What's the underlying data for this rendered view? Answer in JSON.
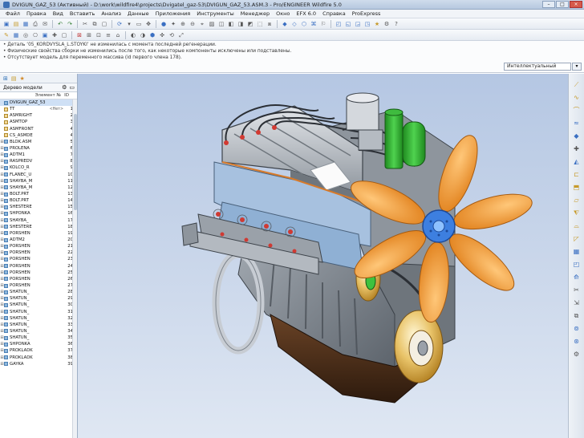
{
  "window": {
    "title": "DVIGUN_GAZ_53 (Активный) - D:\\work\\wildfire4\\projects\\Dvigatel_gaz-53\\DVIGUN_GAZ_53.ASM.3 - Pro/ENGINEER Wildfire 5.0"
  },
  "menu": [
    "Файл",
    "Правка",
    "Вид",
    "Вставить",
    "Анализ",
    "Данные",
    "Приложения",
    "Инструменты",
    "Менеджер",
    "Окно",
    "EFX 6.0",
    "Справка",
    "ProExpress"
  ],
  "messages": [
    "• Деталь ‘05_KORDVYSLA_L.STOYKI’ не изменилась с момента последней регенерации.",
    "• Физические свойства сборки не изменились после того, как некоторые компоненты исключены или подставлены.",
    "• Отсутствует модель для переменного массива (id первого члена 178)."
  ],
  "filter": {
    "value": "Интеллектуальный"
  },
  "left_panel": {
    "title": "Дерево модели",
    "columns": [
      "Элемент №",
      "ID"
    ],
    "tree": [
      {
        "name": "DVIGUN_GAZ_53.ASM",
        "mid": "",
        "idx": ""
      },
      {
        "name": "TT",
        "mid": "<Нет>",
        "idx": "1"
      },
      {
        "name": "ASMRIGHT",
        "mid": "",
        "idx": "2"
      },
      {
        "name": "ASMTOP",
        "mid": "",
        "idx": "3"
      },
      {
        "name": "ASMFRONT",
        "mid": "",
        "idx": "4"
      },
      {
        "name": "CS_ASMDE",
        "mid": "",
        "idx": "4"
      },
      {
        "name": "BLOK.ASM",
        "mid": "",
        "idx": "5"
      },
      {
        "name": "PROLENA",
        "mid": "",
        "idx": "6"
      },
      {
        "name": "ADTM1",
        "mid": "",
        "idx": "7"
      },
      {
        "name": "RASPREDV",
        "mid": "",
        "idx": "8"
      },
      {
        "name": "KOLCO_R",
        "mid": "",
        "idx": "9"
      },
      {
        "name": "FLANEC_U",
        "mid": "",
        "idx": "10"
      },
      {
        "name": "SHAYBA_M",
        "mid": "",
        "idx": "11"
      },
      {
        "name": "SHAYBA_M",
        "mid": "",
        "idx": "12"
      },
      {
        "name": "BOLT.PRT",
        "mid": "",
        "idx": "13"
      },
      {
        "name": "BOLT.PRT",
        "mid": "",
        "idx": "14"
      },
      {
        "name": "SHESTERE",
        "mid": "",
        "idx": "15"
      },
      {
        "name": "SHPONKA",
        "mid": "",
        "idx": "16"
      },
      {
        "name": "SHAYBA_",
        "mid": "",
        "idx": "17"
      },
      {
        "name": "SHESTERE",
        "mid": "",
        "idx": "18"
      },
      {
        "name": "PORSHEN",
        "mid": "",
        "idx": "19"
      },
      {
        "name": "ADTM2",
        "mid": "",
        "idx": "20"
      },
      {
        "name": "PORSHEN",
        "mid": "",
        "idx": "21"
      },
      {
        "name": "PORSHEN",
        "mid": "",
        "idx": "22"
      },
      {
        "name": "PORSHEN",
        "mid": "",
        "idx": "23"
      },
      {
        "name": "PORSHEN",
        "mid": "",
        "idx": "24"
      },
      {
        "name": "PORSHEN",
        "mid": "",
        "idx": "25"
      },
      {
        "name": "PORSHEN",
        "mid": "",
        "idx": "26"
      },
      {
        "name": "PORSHEN",
        "mid": "",
        "idx": "27"
      },
      {
        "name": "SHATUN_",
        "mid": "",
        "idx": "28"
      },
      {
        "name": "SHATUN_",
        "mid": "",
        "idx": "29"
      },
      {
        "name": "SHATUN_",
        "mid": "",
        "idx": "30"
      },
      {
        "name": "SHATUN_",
        "mid": "",
        "idx": "31"
      },
      {
        "name": "SHATUN_",
        "mid": "",
        "idx": "32"
      },
      {
        "name": "SHATUN_",
        "mid": "",
        "idx": "33"
      },
      {
        "name": "SHATUN_",
        "mid": "",
        "idx": "34"
      },
      {
        "name": "SHATUN_",
        "mid": "",
        "idx": "35"
      },
      {
        "name": "SHPONKA",
        "mid": "",
        "idx": "36"
      },
      {
        "name": "PROKLADK",
        "mid": "",
        "idx": "37"
      },
      {
        "name": "PROKLADK",
        "mid": "",
        "idx": "38"
      },
      {
        "name": "GAYKA",
        "mid": "",
        "idx": "39"
      }
    ]
  },
  "colors": {
    "viewport_top": "#b5c7e3",
    "fan": "#f0a03c",
    "hub": "#3d7fe0",
    "oil_filter": "#2bb52b",
    "block": "#8a9199",
    "valve_cover": "#c8ccd2",
    "sump": "#4a2e1a"
  }
}
